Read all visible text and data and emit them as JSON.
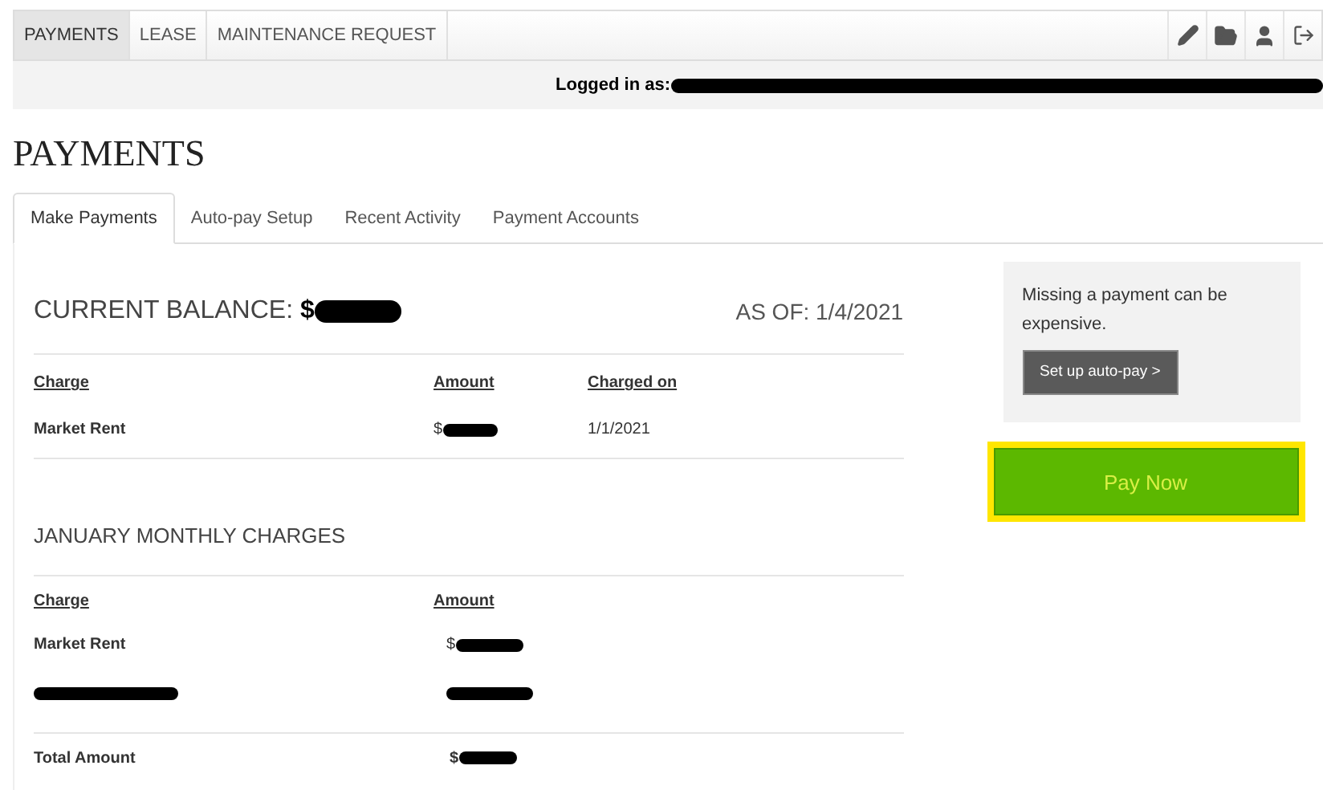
{
  "nav": {
    "items": [
      {
        "label": "PAYMENTS",
        "selected": true
      },
      {
        "label": "LEASE",
        "selected": false
      },
      {
        "label": "MAINTENANCE REQUEST",
        "selected": false
      }
    ]
  },
  "user_bar": {
    "label": "Logged in as:",
    "name_redacted": true
  },
  "page_title": "PAYMENTS",
  "tabs": [
    {
      "label": "Make Payments",
      "selected": true
    },
    {
      "label": "Auto-pay Setup",
      "selected": false
    },
    {
      "label": "Recent Activity",
      "selected": false
    },
    {
      "label": "Payment Accounts",
      "selected": false
    }
  ],
  "balance": {
    "label": "CURRENT BALANCE:",
    "value": "$",
    "value_redacted": true,
    "as_of": "AS OF: 1/4/2021"
  },
  "current_table": {
    "columns": [
      "Charge",
      "Amount",
      "Charged on"
    ],
    "rows": [
      {
        "charge": "Market Rent",
        "amount": "$",
        "amount_redacted": true,
        "charged_on": "1/1/2021"
      }
    ]
  },
  "monthly": {
    "title": "JANUARY MONTHLY CHARGES",
    "columns": [
      "Charge",
      "Amount"
    ],
    "rows": [
      {
        "charge": "Market Rent",
        "amount": "$",
        "charge_redacted": false,
        "amount_redacted": true
      },
      {
        "charge_redacted": true,
        "amount_redacted": true
      }
    ],
    "total": {
      "label": "Total Amount",
      "amount": "$",
      "amount_redacted": true
    }
  },
  "notice": {
    "text": "Missing a payment can be expensive.",
    "button": "Set up auto-pay >"
  },
  "pay_button": {
    "label": "Pay Now",
    "highlighted": true
  }
}
